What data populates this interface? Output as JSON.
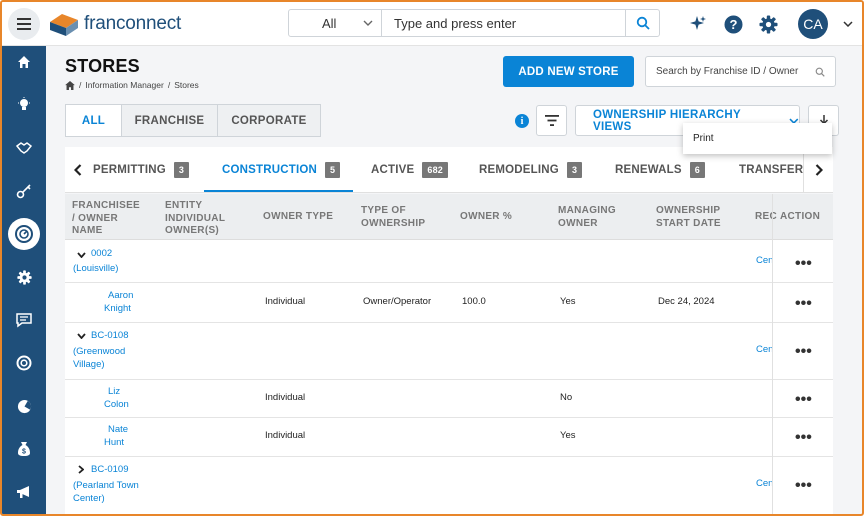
{
  "brand": {
    "name": "franconnect"
  },
  "search": {
    "category": "All",
    "placeholder": "Type and press enter"
  },
  "user": {
    "initials": "CA"
  },
  "page": {
    "title": "STORES",
    "breadcrumbs": [
      "Information Manager",
      "Stores"
    ],
    "add_button": "ADD NEW STORE",
    "filter_search_placeholder": "Search by Franchise ID / Owner"
  },
  "segments": [
    "ALL",
    "FRANCHISE",
    "CORPORATE"
  ],
  "ownership_button": "OWNERSHIP HIERARCHY VIEWS",
  "popup": {
    "item": "Print"
  },
  "tabs": [
    {
      "label": "PERMITTING",
      "count": "3"
    },
    {
      "label": "CONSTRUCTION",
      "count": "5"
    },
    {
      "label": "ACTIVE",
      "count": "682"
    },
    {
      "label": "REMODELING",
      "count": "3"
    },
    {
      "label": "RENEWALS",
      "count": "6"
    },
    {
      "label": "TRANSFER",
      "count": ""
    }
  ],
  "columns": {
    "franchisee": [
      "FRANCHISEE",
      "/ OWNER",
      "NAME"
    ],
    "entity": [
      "ENTITY",
      "INDIVIDUAL",
      "OWNER(S)"
    ],
    "owner_type": [
      "OWNER TYPE"
    ],
    "type_of_ownership": [
      "TYPE OF",
      "OWNERSHIP"
    ],
    "owner_pct": [
      "OWNER %"
    ],
    "managing_owner": [
      "MANAGING",
      "OWNER"
    ],
    "start_date": [
      "OWNERSHIP",
      "START DATE"
    ],
    "rec": [
      "REC"
    ],
    "action": [
      "ACTION"
    ]
  },
  "rows": [
    {
      "kind": "store",
      "expanded": true,
      "id": "0002",
      "place": "(Louisville)",
      "rec": "Cen"
    },
    {
      "kind": "owner",
      "name": [
        "Aaron",
        "Knight"
      ],
      "owner_type": "Individual",
      "type_of_ownership": "Owner/Operator",
      "owner_pct": "100.0",
      "managing": "Yes",
      "start_date": "Dec 24, 2024"
    },
    {
      "kind": "store",
      "expanded": true,
      "id": "BC-0108",
      "place": [
        "(Greenwood",
        "Village)"
      ],
      "rec": "Cen"
    },
    {
      "kind": "owner",
      "name": [
        "Liz",
        "Colon"
      ],
      "owner_type": "Individual",
      "managing": "No"
    },
    {
      "kind": "owner",
      "name": [
        "Nate",
        "Hunt"
      ],
      "owner_type": "Individual",
      "managing": "Yes"
    },
    {
      "kind": "store",
      "expanded": false,
      "id": "BC-0109",
      "place": [
        "(Pearland Town",
        "Center)"
      ],
      "rec": "Cen"
    }
  ],
  "colors": {
    "brand": "#1f4f7a",
    "accent": "#0a84d6",
    "frame": "#e8862a"
  }
}
